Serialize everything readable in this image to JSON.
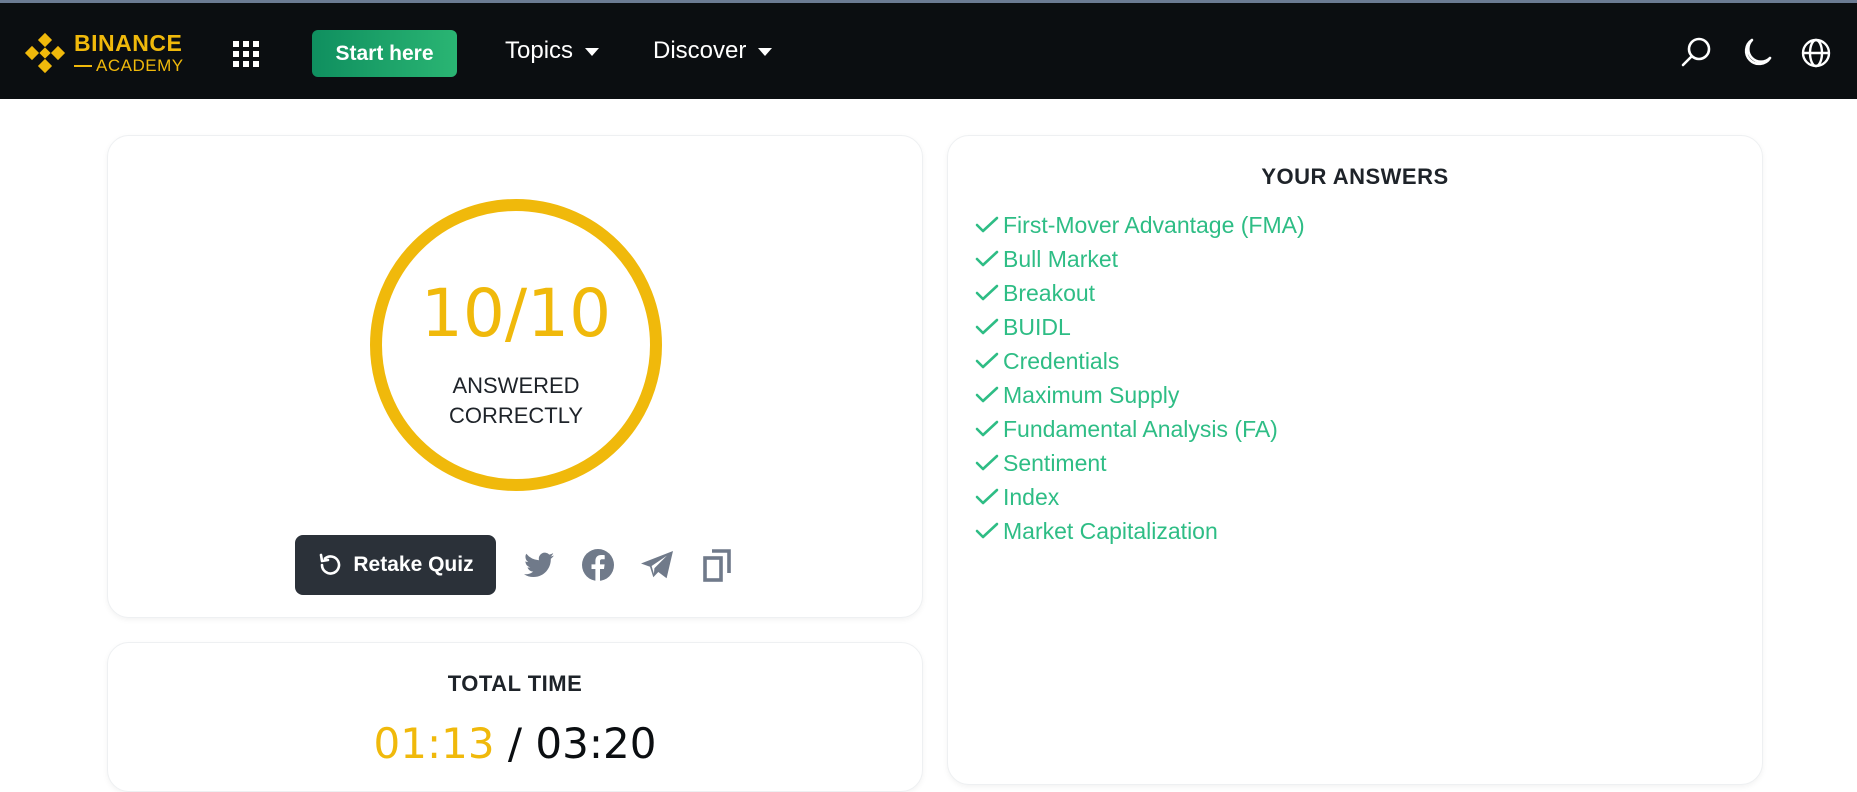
{
  "header": {
    "logo_line1": "BINANCE",
    "logo_line2": "ACADEMY",
    "start_label": "Start here",
    "nav": [
      {
        "label": "Topics"
      },
      {
        "label": "Discover"
      }
    ],
    "icons": [
      "apps-grid-icon",
      "search-icon",
      "moon-icon",
      "globe-icon"
    ]
  },
  "score": {
    "value": "10/10",
    "caption_line1": "ANSWERED",
    "caption_line2": "CORRECTLY",
    "retake_label": "Retake Quiz",
    "share_icons": [
      "twitter-icon",
      "facebook-icon",
      "telegram-icon",
      "copy-icon"
    ]
  },
  "answers": {
    "title": "YOUR ANSWERS",
    "items": [
      {
        "label": "First-Mover Advantage (FMA)",
        "correct": true
      },
      {
        "label": "Bull Market",
        "correct": true
      },
      {
        "label": "Breakout",
        "correct": true
      },
      {
        "label": "BUIDL",
        "correct": true
      },
      {
        "label": "Credentials",
        "correct": true
      },
      {
        "label": "Maximum Supply",
        "correct": true
      },
      {
        "label": "Fundamental Analysis (FA)",
        "correct": true
      },
      {
        "label": "Sentiment",
        "correct": true
      },
      {
        "label": "Index",
        "correct": true
      },
      {
        "label": "Market Capitalization",
        "correct": true
      }
    ]
  },
  "time": {
    "title": "TOTAL TIME",
    "elapsed": "01:13",
    "separator": " / ",
    "total": "03:20"
  },
  "colors": {
    "brand_yellow": "#f0b90b",
    "correct_green": "#2ebd85",
    "nav_bg": "#0b0e11",
    "button_dark": "#2b3139"
  }
}
